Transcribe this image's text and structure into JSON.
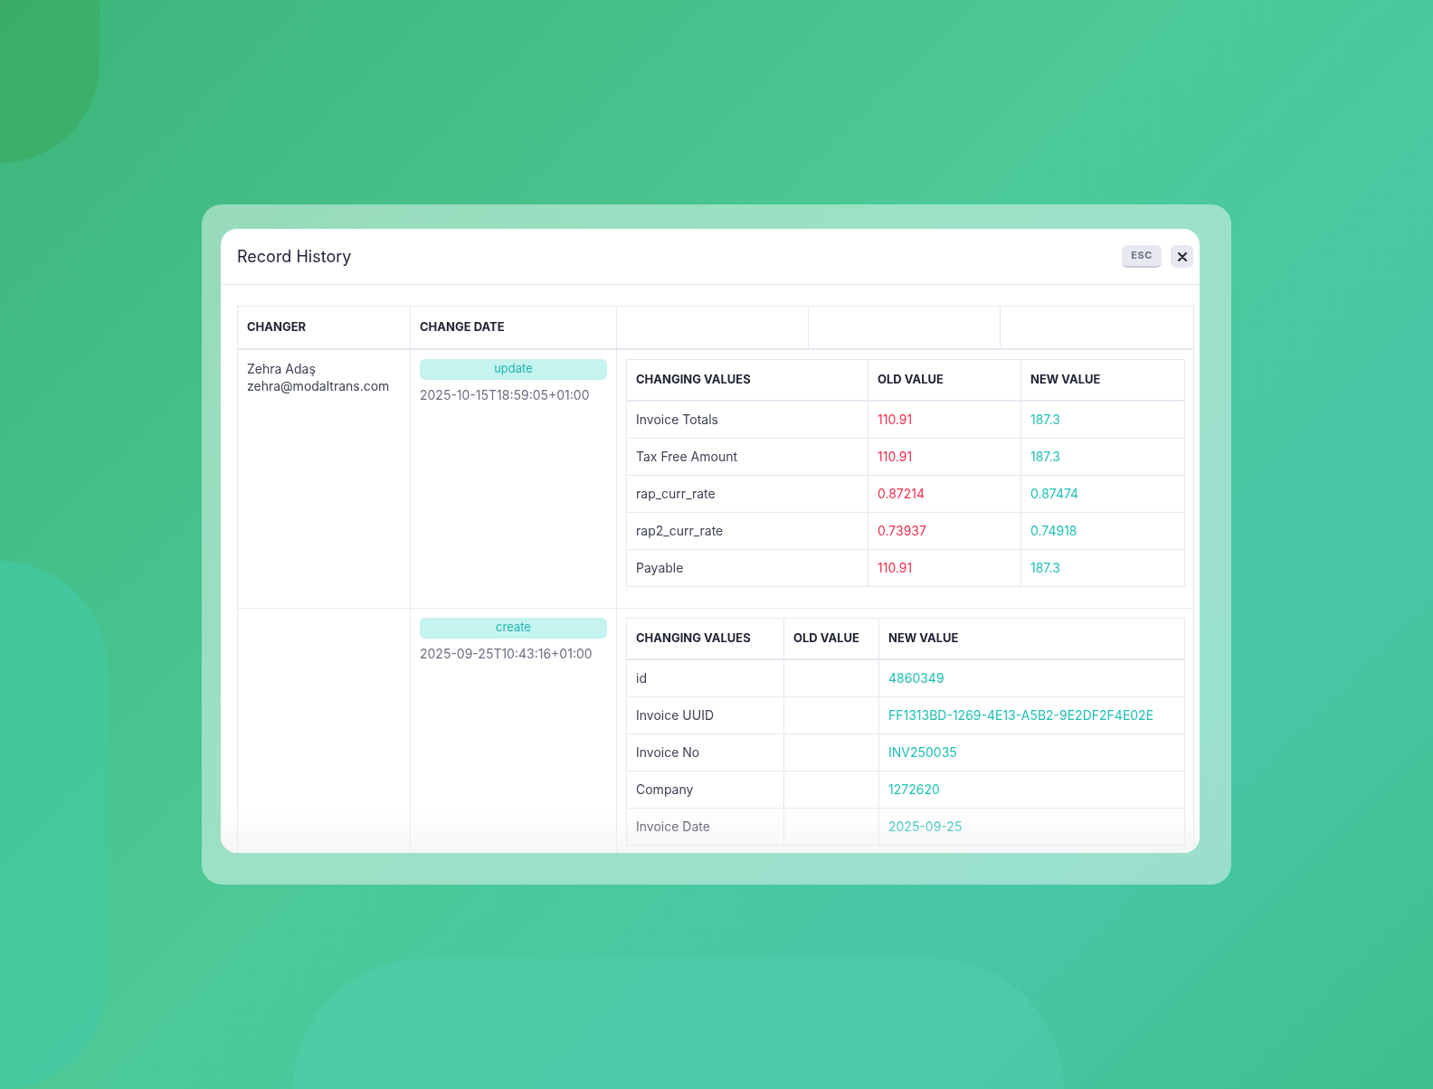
{
  "modal": {
    "title": "Record History",
    "esc_key": "ESC"
  },
  "table": {
    "columns": [
      "CHANGER",
      "CHANGE DATE"
    ],
    "rows": [
      {
        "changer": {
          "name": "Zehra Adaş",
          "email": "zehra@modaltrans.com"
        },
        "action": "update",
        "date": "2025-10-15T18:59:05+01:00",
        "changes": {
          "columns": [
            "CHANGING VALUES",
            "OLD VALUE",
            "NEW VALUE"
          ],
          "rows": [
            {
              "field": "Invoice Totals",
              "old": "110.91",
              "new": "187.3"
            },
            {
              "field": "Tax Free Amount",
              "old": "110.91",
              "new": "187.3"
            },
            {
              "field": "rap_curr_rate",
              "old": "0.87214",
              "new": "0.87474"
            },
            {
              "field": "rap2_curr_rate",
              "old": "0.73937",
              "new": "0.74918"
            },
            {
              "field": "Payable",
              "old": "110.91",
              "new": "187.3"
            }
          ]
        }
      },
      {
        "action": "create",
        "date": "2025-09-25T10:43:16+01:00",
        "changes": {
          "columns": [
            "CHANGING VALUES",
            "OLD VALUE",
            "NEW VALUE"
          ],
          "rows": [
            {
              "field": "id",
              "new": "4860349"
            },
            {
              "field": "Invoice UUID",
              "new": "FF1313BD-1269-4E13-A5B2-9E2DF2F4E02E"
            },
            {
              "field": "Invoice No",
              "new": "INV250035"
            },
            {
              "field": "Company",
              "new": "1272620"
            },
            {
              "field": "Invoice Date",
              "new": "2025-09-25"
            }
          ]
        }
      }
    ]
  }
}
